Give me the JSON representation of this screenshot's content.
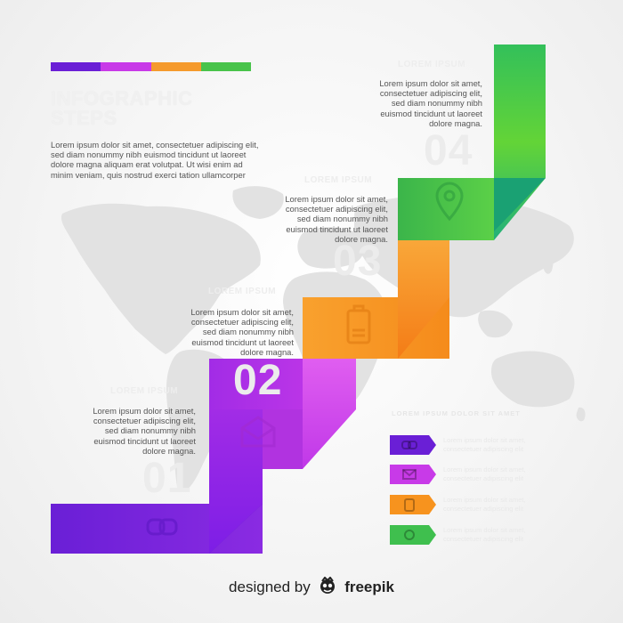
{
  "title": "INFOGRAPHIC STEPS",
  "intro_text": "Lorem ipsum dolor sit amet, consectetuer adipiscing elit, sed diam nonummy nibh euismod tincidunt ut laoreet dolore magna aliquam erat volutpat. Ut wisi enim ad minim veniam, quis nostrud exerci tation ullamcorper",
  "colors": {
    "purple": "#7d1ee6",
    "magenta": "#c83ae8",
    "orange": "#f7931e",
    "green": "#3fbf4e",
    "map": "#e3e3e3"
  },
  "color_bar": [
    "#6a1fd6",
    "#c83ae8",
    "#f59a2c",
    "#48c34a"
  ],
  "steps": [
    {
      "number": "01",
      "heading": "LOREM IPSUM",
      "lines": [
        "Lorem ipsum dolor sit amet,",
        "consectetuer adipiscing elit,",
        "sed diam nonummy nibh",
        "euismod tincidunt ut laoreet",
        "dolore magna."
      ],
      "icon": "link-icon",
      "color": "purple"
    },
    {
      "number": "02",
      "heading": "LOREM IPSUM",
      "lines": [
        "Lorem ipsum dolor sit amet,",
        "consectetuer adipiscing elit,",
        "sed diam nonummy nibh",
        "euismod tincidunt ut laoreet",
        "dolore magna."
      ],
      "icon": "mail-icon",
      "color": "magenta"
    },
    {
      "number": "03",
      "heading": "LOREM IPSUM",
      "lines": [
        "Lorem ipsum dolor sit amet,",
        "consectetuer adipiscing elit,",
        "sed diam nonummy nibh",
        "euismod tincidunt ut laoreet",
        "dolore magna."
      ],
      "icon": "battery-icon",
      "color": "orange"
    },
    {
      "number": "04",
      "heading": "LOREM IPSUM",
      "lines": [
        "Lorem ipsum dolor sit amet,",
        "consectetuer adipiscing elit,",
        "sed diam nonummy nibh",
        "euismod tincidunt ut laoreet",
        "dolore magna."
      ],
      "icon": "location-pin-icon",
      "color": "green"
    }
  ],
  "legend": {
    "title": "LOREM IPSUM DOLOR SIT AMET",
    "items": [
      {
        "icon": "link-icon",
        "color": "#6a1fd6",
        "text": "Lorem ipsum dolor sit amet, consectetuer adipiscing elit"
      },
      {
        "icon": "mail-icon",
        "color": "#c83ae8",
        "text": "Lorem ipsum dolor sit amet, consectetuer adipiscing elit"
      },
      {
        "icon": "battery-icon",
        "color": "#f7931e",
        "text": "Lorem ipsum dolor sit amet, consectetuer adipiscing elit"
      },
      {
        "icon": "location-pin-icon",
        "color": "#3fbf4e",
        "text": "Lorem ipsum dolor sit amet, consectetuer adipiscing elit"
      }
    ]
  },
  "credit": {
    "prefix": "designed by",
    "brand": "freepik"
  }
}
